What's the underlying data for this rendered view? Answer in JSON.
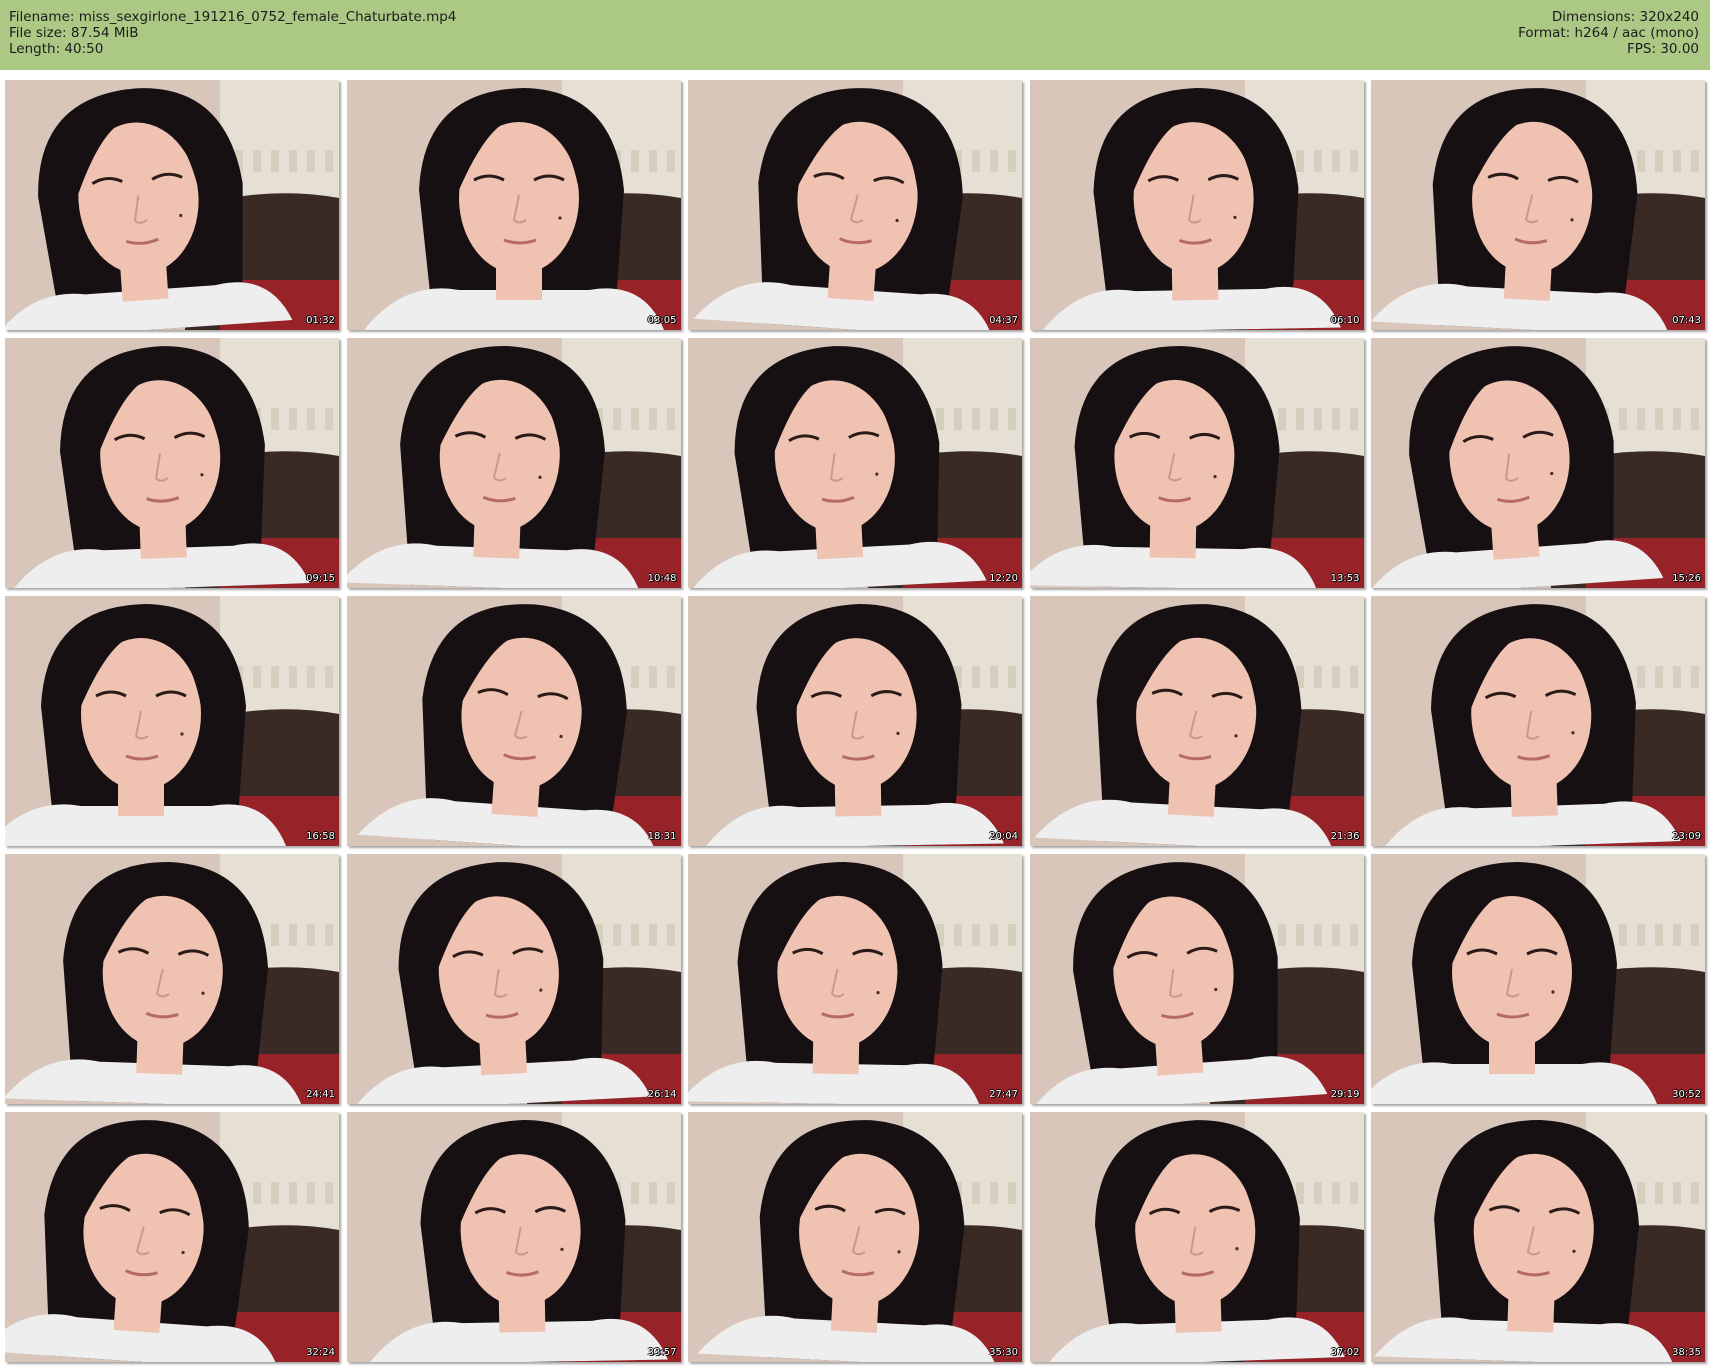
{
  "header": {
    "filename": "Filename: miss_sexgirlone_191216_0752_female_Chaturbate.mp4",
    "filesize": "File size: 87.54 MiB",
    "length": "Length: 40:50",
    "dimensions": "Dimensions: 320x240",
    "format": "Format: h264 / aac (mono)",
    "fps": "FPS: 30.00"
  },
  "thumbnails": [
    {
      "timestamp": "01:32"
    },
    {
      "timestamp": "03:05"
    },
    {
      "timestamp": "04:37"
    },
    {
      "timestamp": "06:10"
    },
    {
      "timestamp": "07:43"
    },
    {
      "timestamp": "09:15"
    },
    {
      "timestamp": "10:48"
    },
    {
      "timestamp": "12:20"
    },
    {
      "timestamp": "13:53"
    },
    {
      "timestamp": "15:26"
    },
    {
      "timestamp": "16:58"
    },
    {
      "timestamp": "18:31"
    },
    {
      "timestamp": "20:04"
    },
    {
      "timestamp": "21:36"
    },
    {
      "timestamp": "23:09"
    },
    {
      "timestamp": "24:41"
    },
    {
      "timestamp": "26:14"
    },
    {
      "timestamp": "27:47"
    },
    {
      "timestamp": "29:19"
    },
    {
      "timestamp": "30:52"
    },
    {
      "timestamp": "32:24"
    },
    {
      "timestamp": "33:57"
    },
    {
      "timestamp": "35:30"
    },
    {
      "timestamp": "37:02"
    },
    {
      "timestamp": "38:35"
    }
  ],
  "colors": {
    "header_bg": "#abc885",
    "wall": "#d9c6bb",
    "curtain": "#e6e2d6",
    "headboard": "#3a2a26",
    "hair": "#161012",
    "skin": "#f0c2b2",
    "shirt": "#eeeeee",
    "blanket": "#a8222a"
  }
}
